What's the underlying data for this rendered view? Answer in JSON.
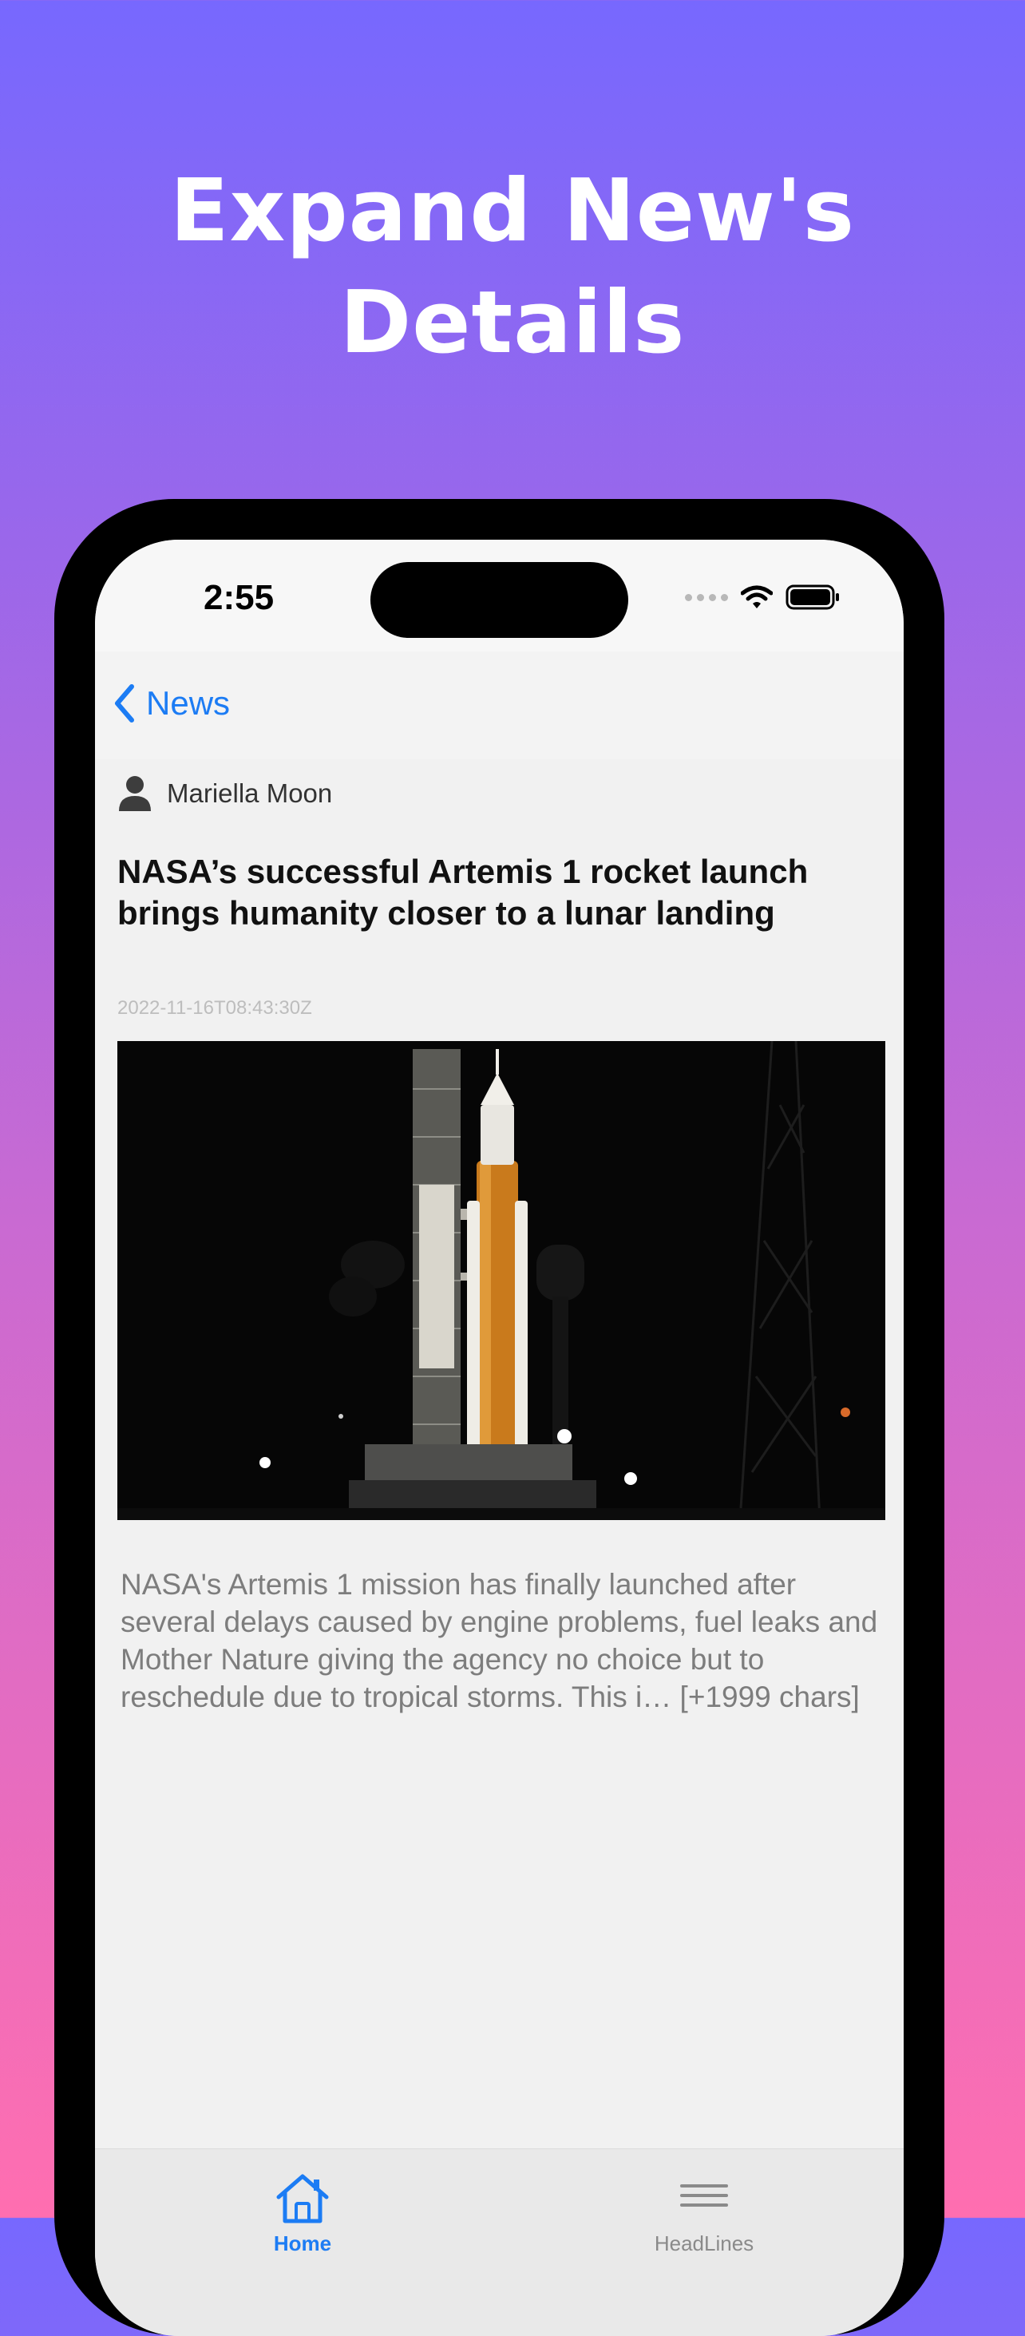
{
  "promo": {
    "headline": "Expand New's Details"
  },
  "status_bar": {
    "time": "2:55"
  },
  "nav": {
    "back_label": "News"
  },
  "article": {
    "author": "Mariella Moon",
    "title": "NASA’s successful Artemis 1 rocket launch brings humanity closer to a lunar landing",
    "published_at": "2022-11-16T08:43:30Z",
    "description": "NASA's Artemis 1 mission has finally launched after several delays caused by engine problems, fuel leaks and Mother Nature giving the agency no choice but to reschedule due to tropical storms. This i… [+1999 chars]"
  },
  "tab_bar": {
    "tabs": [
      {
        "label": "Home",
        "icon": "house-icon",
        "selected": true
      },
      {
        "label": "HeadLines",
        "icon": "lines-icon",
        "selected": false
      }
    ]
  },
  "colors": {
    "accent": "#1c7cf4",
    "gradient_top": "#7768fe",
    "gradient_bottom": "#ff6eb0"
  }
}
